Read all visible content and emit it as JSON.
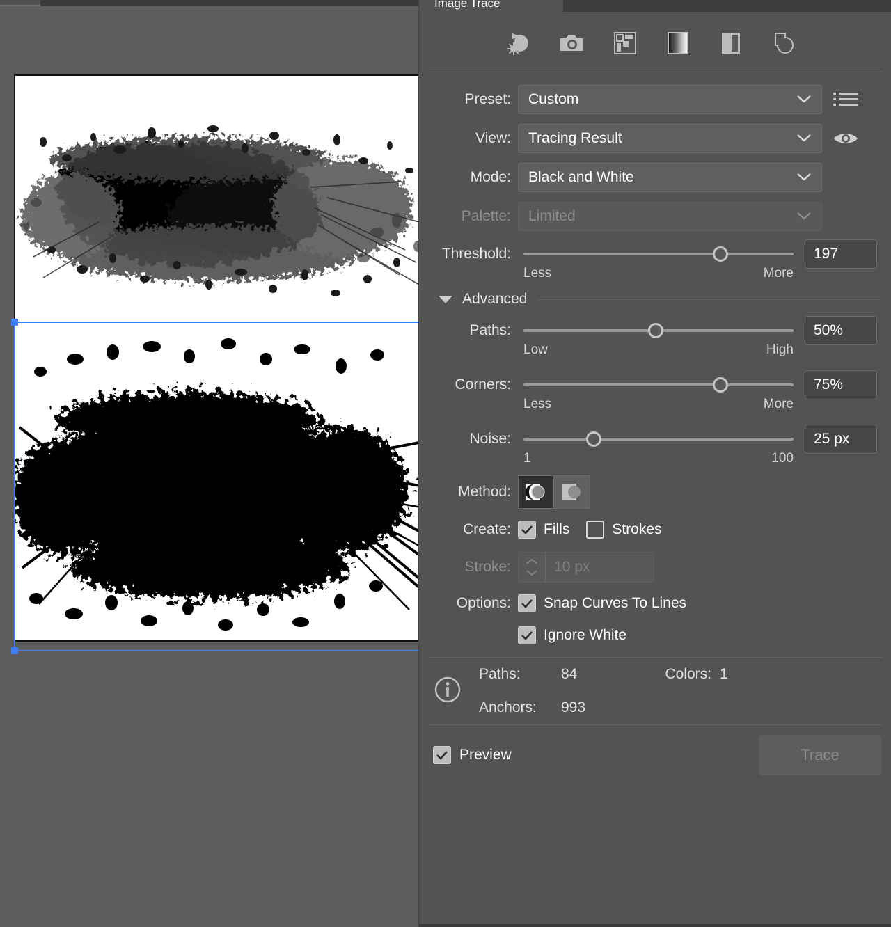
{
  "panel": {
    "tab_active_label": "Image Trace",
    "preset_icons": [
      {
        "name": "auto-color-icon",
        "title": "Auto-Color"
      },
      {
        "name": "high-color-icon",
        "title": "High Color"
      },
      {
        "name": "low-color-icon",
        "title": "Low Color"
      },
      {
        "name": "grayscale-icon",
        "title": "Grayscale"
      },
      {
        "name": "black-and-white-icon",
        "title": "Black and White"
      },
      {
        "name": "outline-icon",
        "title": "Outline"
      }
    ],
    "preset": {
      "label": "Preset:",
      "value": "Custom",
      "menu_icon": "list-menu-icon"
    },
    "view": {
      "label": "View:",
      "value": "Tracing Result",
      "eye_icon": "eye-icon"
    },
    "mode": {
      "label": "Mode:",
      "value": "Black and White"
    },
    "palette": {
      "label": "Palette:",
      "value": "Limited",
      "disabled": true
    },
    "threshold": {
      "label": "Threshold:",
      "value": "197",
      "min_label": "Less",
      "max_label": "More",
      "percent": 73
    },
    "advanced": {
      "label": "Advanced",
      "expanded": true
    },
    "paths": {
      "label": "Paths:",
      "value": "50%",
      "min_label": "Low",
      "max_label": "High",
      "percent": 49
    },
    "corners": {
      "label": "Corners:",
      "value": "75%",
      "min_label": "Less",
      "max_label": "More",
      "percent": 73
    },
    "noise": {
      "label": "Noise:",
      "value": "25 px",
      "min_label": "1",
      "max_label": "100",
      "percent": 26
    },
    "method": {
      "label": "Method:",
      "selected_index": 0,
      "options": [
        "abutting-method-icon",
        "overlapping-method-icon"
      ]
    },
    "create": {
      "label": "Create:",
      "fills_label": "Fills",
      "fills_checked": true,
      "strokes_label": "Strokes",
      "strokes_checked": false
    },
    "stroke": {
      "label": "Stroke:",
      "value": "10 px",
      "disabled": true
    },
    "options": {
      "label": "Options:",
      "snap_label": "Snap Curves To Lines",
      "snap_checked": true,
      "ignore_white_label": "Ignore White",
      "ignore_white_checked": true
    },
    "info": {
      "icon": "info-icon",
      "paths_key": "Paths:",
      "paths_value": "84",
      "colors_key": "Colors:",
      "colors_value": "1",
      "anchors_key": "Anchors:",
      "anchors_value": "993"
    },
    "footer": {
      "preview_label": "Preview",
      "preview_checked": true,
      "trace_label": "Trace",
      "trace_disabled": true
    }
  },
  "canvas": {
    "artwork_top_name": "grayscale-ink-splatter-source",
    "artwork_bottom_name": "black-white-traced-splatter",
    "selection_color": "#3d7ffb"
  },
  "colors": {
    "panel_bg": "#535353",
    "canvas_bg": "#5d5d5d",
    "field_bg": "#5f5f5f",
    "numbox_bg": "#474747",
    "text": "#ffffff",
    "label": "#e3e3e3",
    "disabled": "#8c8c8c",
    "accent_selection": "#3d7ffb"
  }
}
